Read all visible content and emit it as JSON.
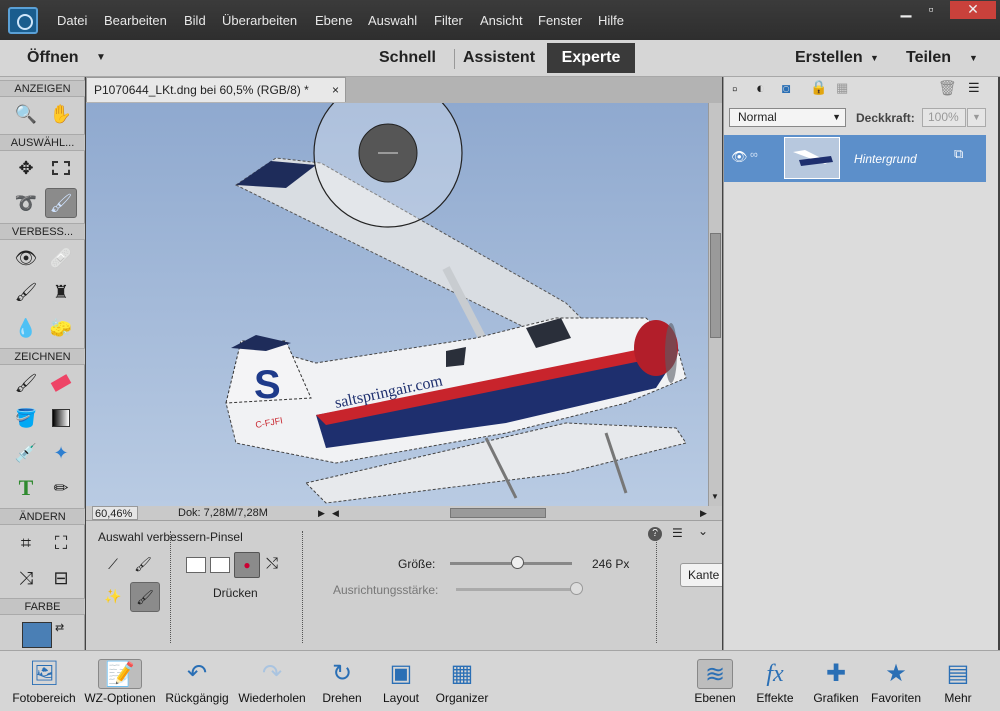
{
  "menu": [
    "Datei",
    "Bearbeiten",
    "Bild",
    "Überarbeiten",
    "Ebene",
    "Auswahl",
    "Filter",
    "Ansicht",
    "Fenster",
    "Hilfe"
  ],
  "modebar": {
    "open_label": "Öffnen",
    "modes": [
      "Schnell",
      "Assistent",
      "Experte"
    ],
    "active_mode": "Experte",
    "create_label": "Erstellen",
    "share_label": "Teilen"
  },
  "toolbar": {
    "sections": [
      "ANZEIGEN",
      "AUSWÄHL...",
      "VERBESS...",
      "ZEICHNEN",
      "ÄNDERN",
      "FARBE"
    ]
  },
  "document": {
    "tab_title": "P1070644_LKt.dng bei 60,5% (RGB/8) *",
    "close_glyph": "×",
    "zoom": "60,46%",
    "doc_info": "Dok: 7,28M/7,28M"
  },
  "photo": {
    "tail_letter": "S",
    "fuselage_text": "saltspringair.com",
    "registration": "C-FJFI"
  },
  "options": {
    "tool_name": "Auswahl verbessern-Pinsel",
    "push_label": "Drücken",
    "size_label": "Größe:",
    "size_value": "246 Px",
    "size_fraction": 0.55,
    "snap_label": "Ausrichtungsstärke:",
    "snap_fraction": 0.95,
    "edge_button": "Kante"
  },
  "layers": {
    "blend_mode": "Normal",
    "opacity_label": "Deckkraft:",
    "opacity_value": "100%",
    "layer_name": "Hintergrund"
  },
  "bottom": [
    "Fotobereich",
    "WZ-Optionen",
    "Rückgängig",
    "Wiederholen",
    "Drehen",
    "Layout",
    "Organizer",
    "Ebenen",
    "Effekte",
    "Grafiken",
    "Favoriten",
    "Mehr"
  ],
  "colors": {
    "accent": "#5c8fca",
    "title_bg": "#333333",
    "foreground_swatch": "#4a7fb5"
  }
}
